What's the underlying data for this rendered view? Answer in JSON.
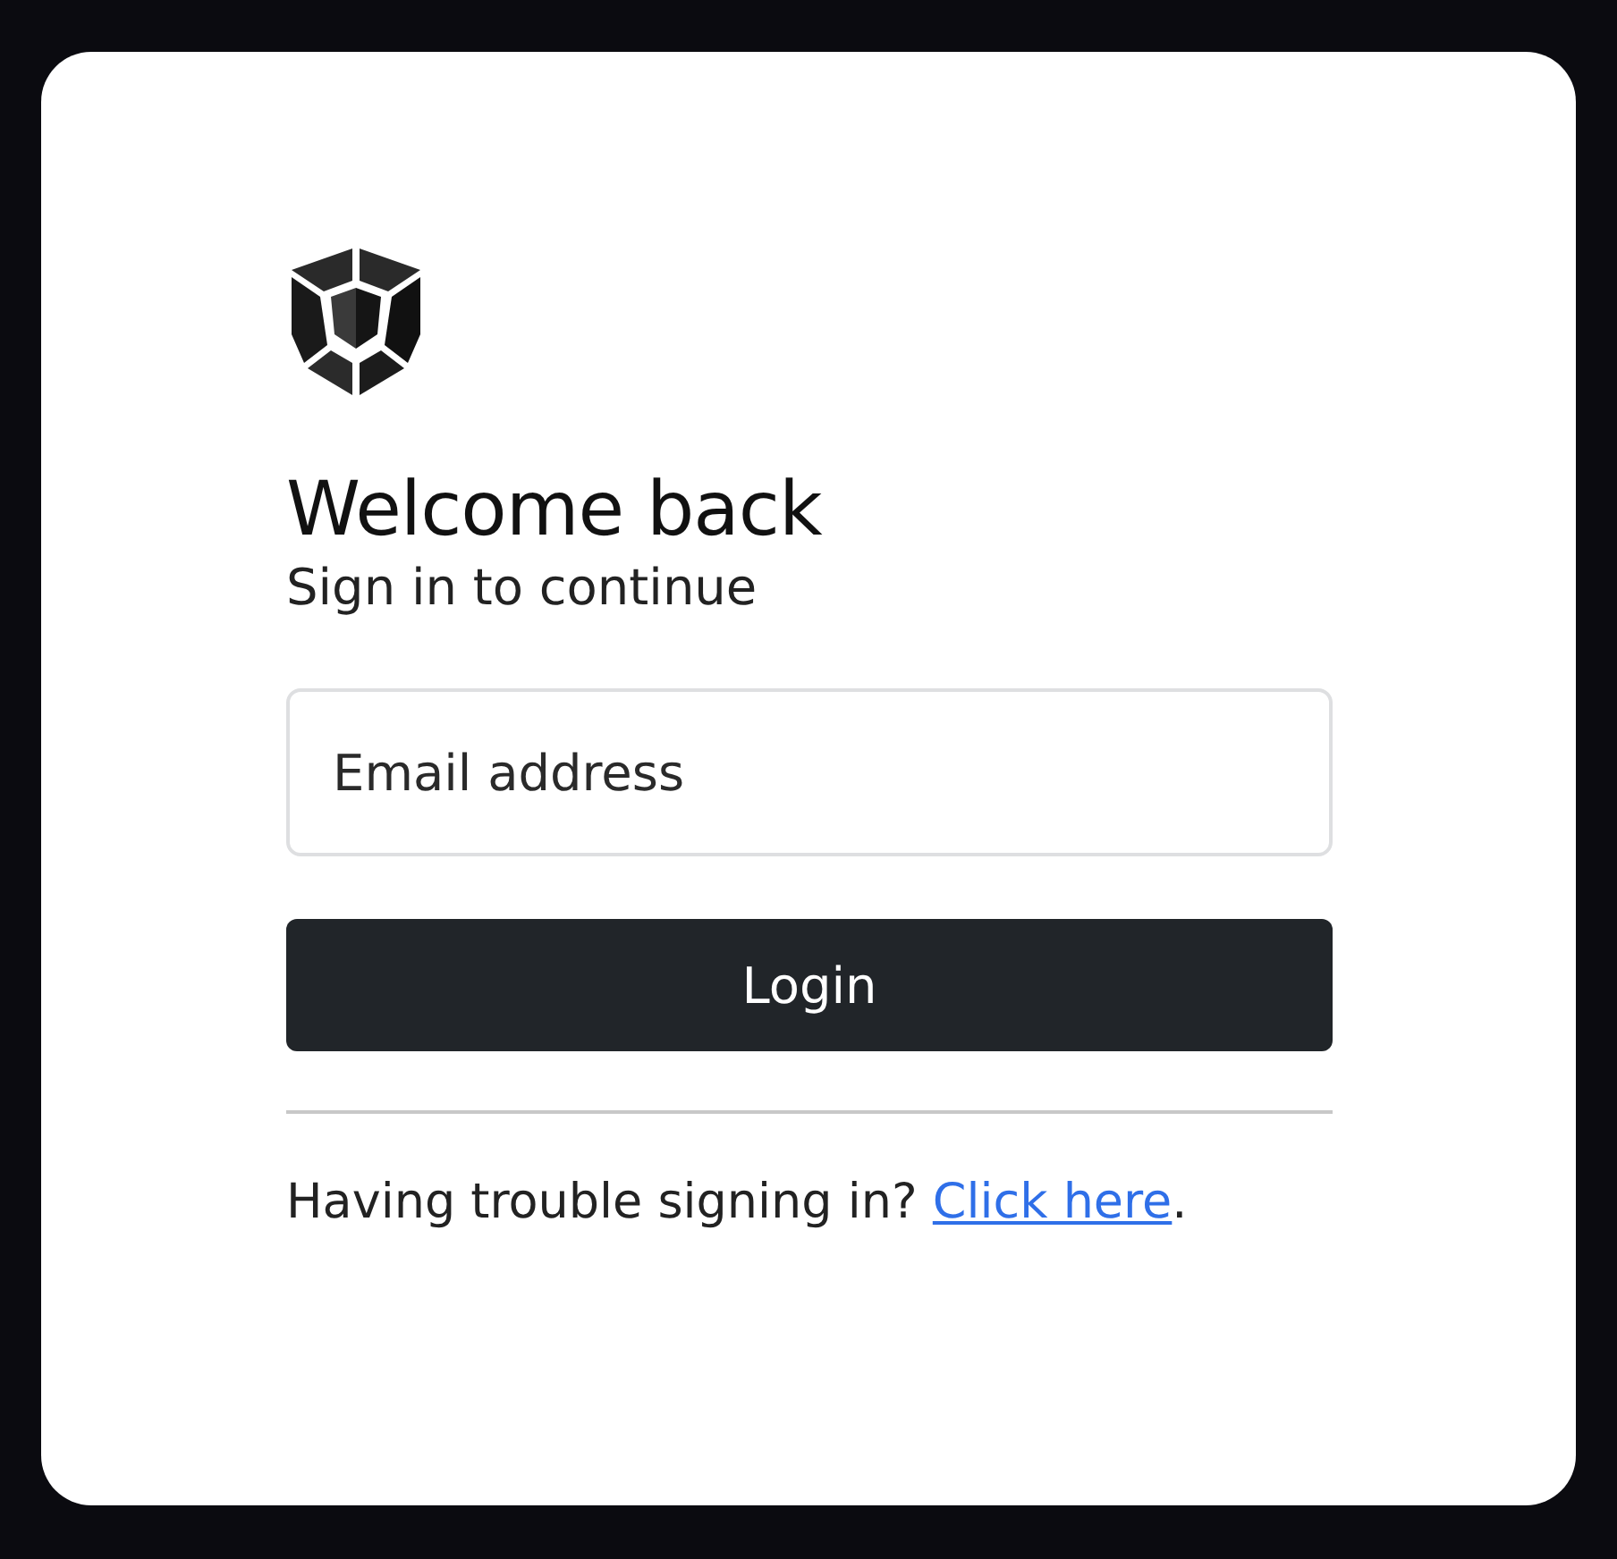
{
  "heading": "Welcome back",
  "subheading": "Sign in to continue",
  "email_field": {
    "placeholder": "Email address"
  },
  "login_button": "Login",
  "help": {
    "text": "Having trouble signing in?",
    "link": "Click here",
    "end": "."
  }
}
